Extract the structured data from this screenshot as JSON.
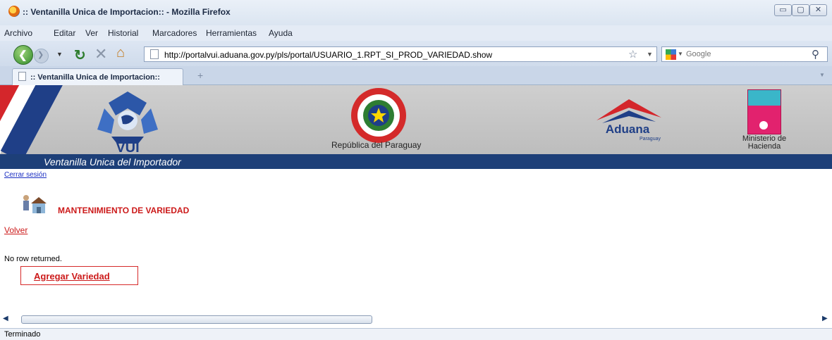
{
  "window": {
    "title": ":: Ventanilla Unica de Importacion:: - Mozilla Firefox",
    "minimize_glyph": "▭",
    "maximize_glyph": "▢",
    "close_glyph": "✕"
  },
  "menubar": {
    "items": [
      "Archivo",
      "Editar",
      "Ver",
      "Historial",
      "Marcadores",
      "Herramientas",
      "Ayuda"
    ]
  },
  "navbar": {
    "url": "http://portalvui.aduana.gov.py/pls/portal/USUARIO_1.RPT_SI_PROD_VARIEDAD.show",
    "search_placeholder": "Google",
    "icons": [
      "back-arrow-icon",
      "forward-arrow-icon",
      "reload-icon",
      "stop-icon",
      "home-icon",
      "page-icon",
      "star-icon",
      "search-engine-icon",
      "magnifier-icon"
    ]
  },
  "tabs": [
    {
      "label": ":: Ventanilla Unica de Importacion::"
    }
  ],
  "header": {
    "vui_text": "VUI",
    "republic_label": "República del Paraguay",
    "aduana_text": "Aduana",
    "aduana_sub": "Paraguay",
    "hacienda_label_line1": "Ministerio de",
    "hacienda_label_line2": "Hacienda",
    "portal_title": "Ventanilla Unica del Importador",
    "colors": {
      "title_strip": "#1d3f78",
      "stripe_red": "#d4262b",
      "stripe_blue": "#1f3f87"
    }
  },
  "content": {
    "logout_link": "Cerrar sesión",
    "section_title": "MANTENIMIENTO DE VARIEDAD",
    "back_link": "Volver",
    "empty_message": "No row returned.",
    "add_button": "Agregar Variedad",
    "accent_color": "#cc1a1a"
  },
  "statusbar": {
    "text": "Terminado"
  }
}
